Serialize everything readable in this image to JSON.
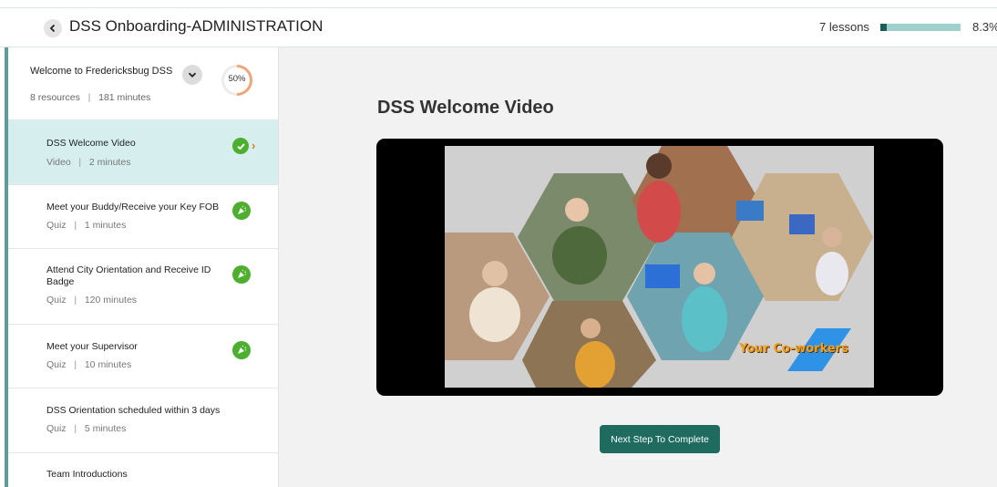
{
  "header": {
    "course_title": "DSS Onboarding-ADMINISTRATION",
    "lessons_count": "7 lessons",
    "progress_percent": "8.3%",
    "progress_value": 0.083
  },
  "sidebar": {
    "section": {
      "title": "Welcome to Fredericksbug DSS",
      "resources": "8 resources",
      "minutes": "181 minutes",
      "progress_label": "50%",
      "progress_value": 0.5
    },
    "items": [
      {
        "title": "DSS Welcome Video",
        "type": "Video",
        "duration": "2 minutes",
        "status": "completed",
        "active": true
      },
      {
        "title": "Meet your Buddy/Receive your Key FOB",
        "type": "Quiz",
        "duration": "1 minutes",
        "status": "celebrate"
      },
      {
        "title": "Attend City Orientation and Receive ID Badge",
        "type": "Quiz",
        "duration": "120 minutes",
        "status": "celebrate"
      },
      {
        "title": "Meet your Supervisor",
        "type": "Quiz",
        "duration": "10 minutes",
        "status": "celebrate"
      },
      {
        "title": "DSS Orientation scheduled within 3 days",
        "type": "Quiz",
        "duration": "5 minutes",
        "status": "none"
      },
      {
        "title": "Team Introductions",
        "type": "",
        "duration": "",
        "status": "none"
      }
    ]
  },
  "main": {
    "video_title": "DSS Welcome Video",
    "video_caption": "Your Co-workers",
    "next_button": "Next Step To Complete"
  },
  "colors": {
    "accent_teal": "#1f6b60",
    "active_row": "#d6eeee",
    "success_green": "#4caf2d",
    "progress_track": "#9fd1cc"
  }
}
